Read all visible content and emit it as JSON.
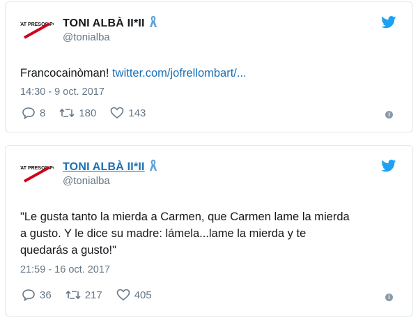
{
  "tweets": [
    {
      "avatar_text": "LLIBERTAT PRESOS POLÍTICS!",
      "name": "TONI ALBÀ II*II",
      "handle": "@tonialba",
      "text_prefix": "Francocainòman! ",
      "link": "twitter.com/jofrellombart/...",
      "time": "14:30 - 9 oct. 2017",
      "replies": "8",
      "retweets": "180",
      "likes": "143"
    },
    {
      "avatar_text": "LLIBERTAT PRESOS POLÍTICS!",
      "name": "TONI ALBÀ II*II",
      "handle": "@tonialba",
      "text": "\"Le gusta tanto la mierda a Carmen, que Carmen lame la mierda\na gusto. Y le dice su madre: lámela...lame la mierda y te\nquedarás a gusto!\"",
      "time": "21:59 - 16 oct. 2017",
      "replies": "36",
      "retweets": "217",
      "likes": "405"
    }
  ],
  "icons": {
    "bird": "twitter-bird-icon",
    "ribbon": "yellow-ribbon-icon",
    "reply": "reply-icon",
    "retweet": "retweet-icon",
    "like": "heart-icon",
    "info": "info-icon"
  },
  "colors": {
    "twitter_blue": "#1da1f2",
    "link": "#1b6fb5",
    "muted": "#657786",
    "ribbon": "#5aa3d9"
  }
}
